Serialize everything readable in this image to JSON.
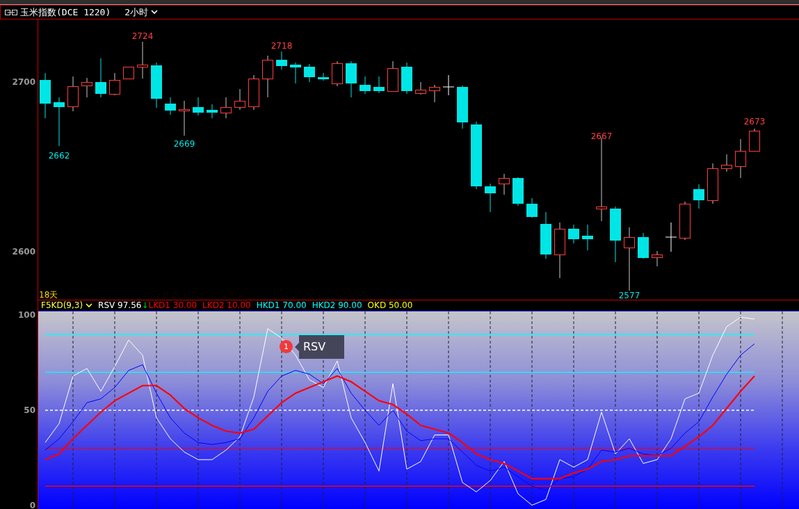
{
  "title_bar": {
    "instrument": "玉米指数(DCE 1220)",
    "period": "2小时"
  },
  "price_panel": {
    "axis_labels": [
      "2700",
      "2600"
    ],
    "extreme_labels": [
      {
        "text": "2724",
        "kind": "high"
      },
      {
        "text": "2662",
        "kind": "low"
      },
      {
        "text": "2669",
        "kind": "low"
      },
      {
        "text": "2718",
        "kind": "high"
      },
      {
        "text": "2667",
        "kind": "high"
      },
      {
        "text": "2577",
        "kind": "low"
      },
      {
        "text": "2673",
        "kind": "high"
      }
    ],
    "span_label": "18天"
  },
  "indicator_legend": {
    "name": "F5KD(9,3)",
    "items": [
      {
        "text": "RSV 97.56",
        "color": "#ffffff",
        "arrow": "↓"
      },
      {
        "text": "LKD1 30.00",
        "color": "#ff0000"
      },
      {
        "text": "LKD2 10.00",
        "color": "#ff0000"
      },
      {
        "text": "HKD1 70.00",
        "color": "#00ffff"
      },
      {
        "text": "HKD2 90.00",
        "color": "#00ffff"
      },
      {
        "text": "OKD 50.00",
        "color": "#ffff00"
      }
    ]
  },
  "indicator_panel": {
    "chart_data": {
      "type": "line",
      "ylim": [
        -2,
        102
      ],
      "yticks": [
        0,
        50,
        100
      ],
      "grid": true,
      "series": [
        {
          "color": "#ffffff",
          "values": [
            33,
            43,
            68,
            72,
            60,
            73,
            87,
            79,
            46,
            35,
            28,
            24,
            24,
            29,
            36,
            57,
            93,
            88,
            79,
            66,
            62,
            76,
            46,
            33,
            18,
            64,
            19,
            23,
            37,
            37,
            12,
            7,
            13,
            23,
            6,
            0,
            3,
            24,
            20,
            24,
            49,
            27,
            35,
            22,
            24,
            35,
            56,
            59,
            79,
            94,
            99,
            98
          ]
        },
        {
          "color": "#0000ff",
          "values": [
            29,
            35,
            44,
            54,
            56,
            62,
            71,
            74,
            59,
            46,
            38,
            33,
            32,
            33,
            35,
            46,
            60,
            68,
            71,
            69,
            64,
            72,
            59,
            50,
            42,
            50,
            39,
            34,
            35,
            35,
            28,
            21,
            18,
            20,
            15,
            10,
            8,
            14,
            15,
            19,
            29,
            28,
            30,
            27,
            26,
            30,
            38,
            44,
            57,
            69,
            79,
            85
          ]
        },
        {
          "color": "#ff0000",
          "values": [
            24,
            27,
            35,
            42,
            49,
            55,
            59,
            63,
            63,
            58,
            51,
            46,
            42,
            39,
            38,
            40,
            47,
            54,
            59,
            62,
            65,
            68,
            65,
            60,
            55,
            53,
            48,
            42,
            40,
            38,
            33,
            27,
            24,
            22,
            18,
            14,
            14,
            14,
            17,
            19,
            23,
            24,
            26,
            26,
            26,
            26,
            31,
            36,
            42,
            51,
            60,
            68
          ]
        }
      ],
      "ref_lines": [
        {
          "axis": "y",
          "value": 90,
          "color": "#00ffff"
        },
        {
          "axis": "y",
          "value": 70,
          "color": "#00ffff"
        },
        {
          "axis": "y",
          "value": 50,
          "color": "#ffffff"
        },
        {
          "axis": "y",
          "value": 30,
          "color": "#ff0000"
        },
        {
          "axis": "y",
          "value": 10,
          "color": "#ff0000"
        }
      ]
    },
    "tooltip": {
      "marker": "1",
      "text": "RSV"
    }
  }
}
